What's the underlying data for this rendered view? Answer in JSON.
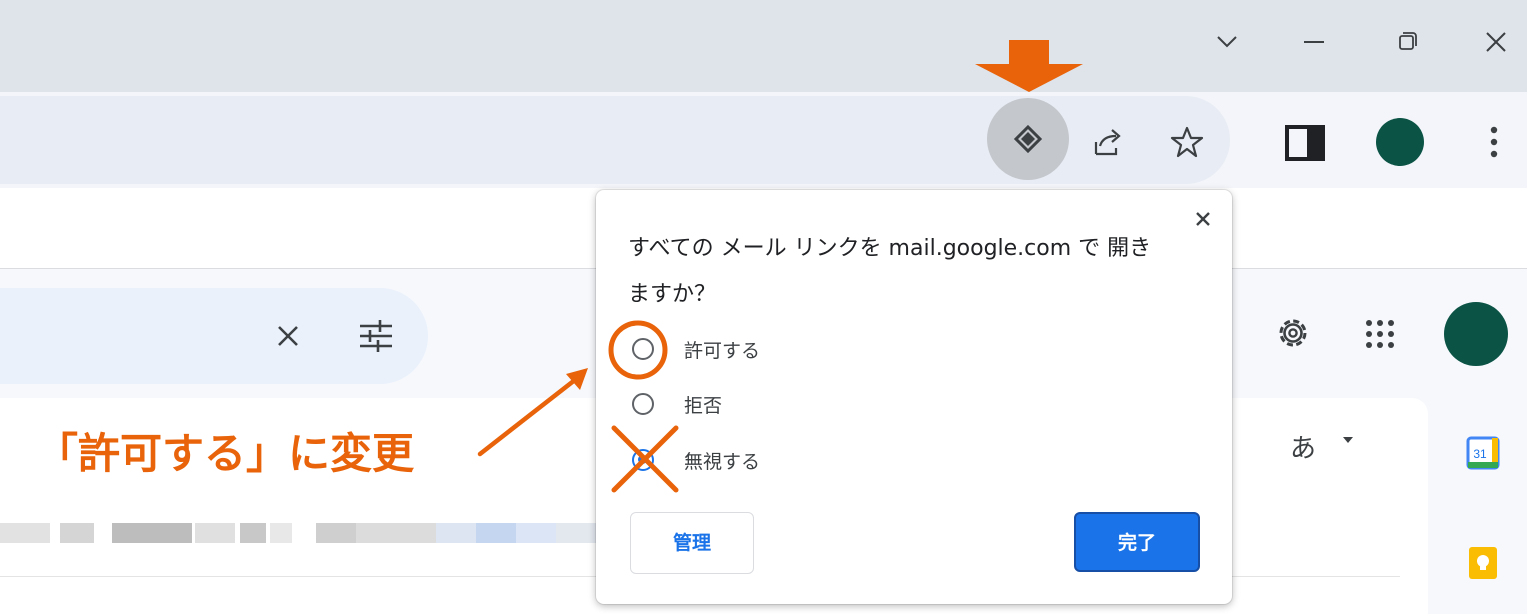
{
  "colors": {
    "accent": "#1a73e8",
    "annotation": "#e8630a",
    "avatar": "#0b5345",
    "titlebar": "#dfe3ea"
  },
  "window": {
    "controls": [
      "chevron-down-icon",
      "minimize-icon",
      "restore-icon",
      "close-icon"
    ]
  },
  "toolbar": {
    "icons": [
      "protocol-handler-icon",
      "share-icon",
      "star-icon",
      "side-panel-icon",
      "profile-avatar",
      "kebab-menu-icon"
    ]
  },
  "popup": {
    "title": "すべての メール リンクを mail.google.com で 開きますか？",
    "options": [
      {
        "label": "許可する",
        "selected": false
      },
      {
        "label": "拒否",
        "selected": false
      },
      {
        "label": "無視する",
        "selected": true
      }
    ],
    "manage_label": "管理",
    "done_label": "完了"
  },
  "gmail": {
    "input_tools_label": "あ"
  },
  "side_apps": [
    "calendar-icon",
    "keep-icon"
  ],
  "calendar_day": "31",
  "annotation": {
    "callout_text": "「許可する」に変更"
  }
}
